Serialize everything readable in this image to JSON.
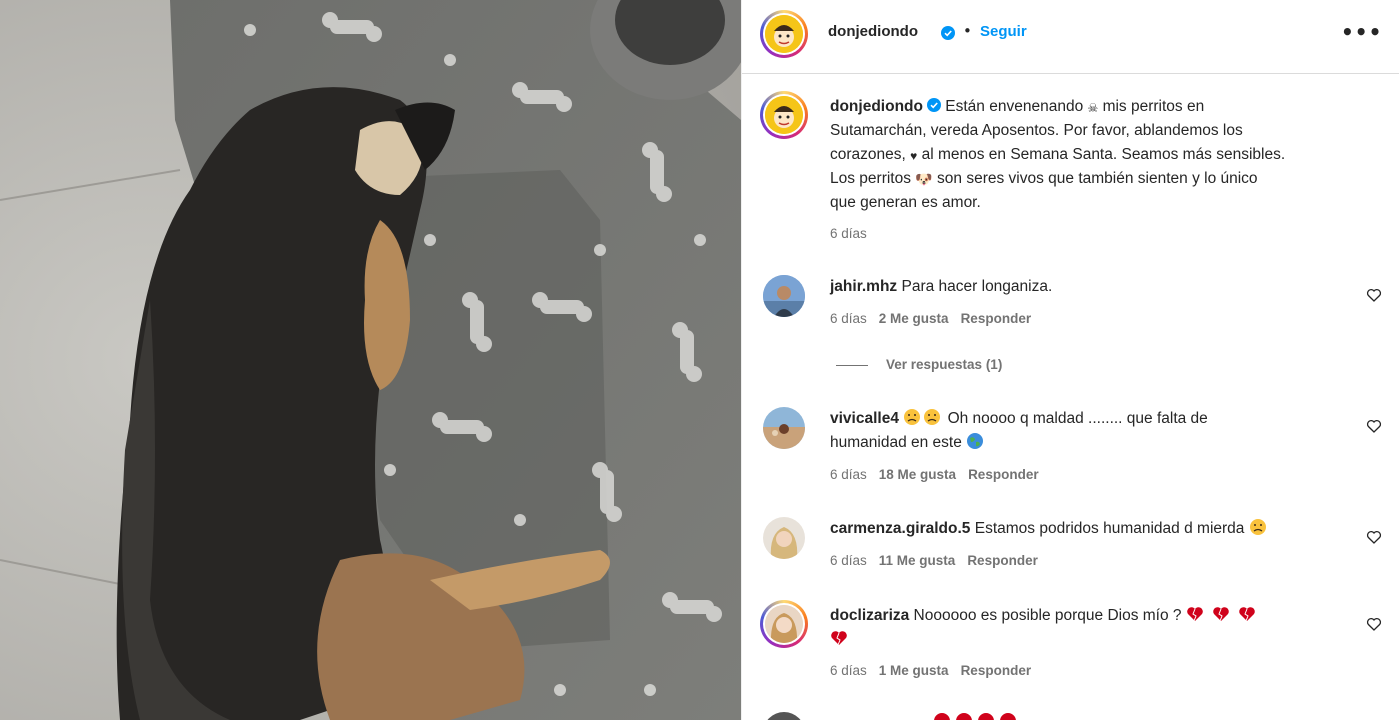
{
  "post": {
    "username": "donjediondo",
    "follow_label": "Seguir",
    "more_label": "•••"
  },
  "caption": {
    "username": "donjediondo",
    "line1": " Están envenenando",
    "emoji_skull": "☠",
    "line1b": " mis perritos en",
    "line2": "Sutamarchán, vereda Aposentos. Por favor, ablandemos los",
    "line3a": "corazones,",
    "emoji_heart": "♥",
    "line3b": " al menos en Semana Santa. Seamos más sensibles.",
    "line4a": "Los perritos",
    "emoji_dog": "🐶",
    "line4b": " son seres vivos que también sienten y lo único",
    "line5": "que generan es amor.",
    "time": "6 días"
  },
  "comments": [
    {
      "username": "jahir.mhz",
      "text": " Para hacer longaniza.",
      "time": "6 días",
      "likes": "2 Me gusta",
      "reply": "Responder",
      "view_replies": "Ver respuestas (1)"
    },
    {
      "username": "vivicalle4",
      "text_line1": " Oh noooo q maldad ........ que falta de",
      "text_line2": "humanidad en este",
      "time": "6 días",
      "likes": "18 Me gusta",
      "reply": "Responder"
    },
    {
      "username": "carmenza.giraldo.5",
      "text": " Estamos podridos humanidad d mierda",
      "time": "6 días",
      "likes": "11 Me gusta",
      "reply": "Responder"
    },
    {
      "username": "doclizariza",
      "text": " Noooooo es posible porque Dios mío ?",
      "time": "6 días",
      "likes": "1 Me gusta",
      "reply": "Responder"
    }
  ],
  "colors": {
    "accent": "#0095f6",
    "text": "#262626",
    "muted": "#737373",
    "verified": "#0095f6"
  }
}
